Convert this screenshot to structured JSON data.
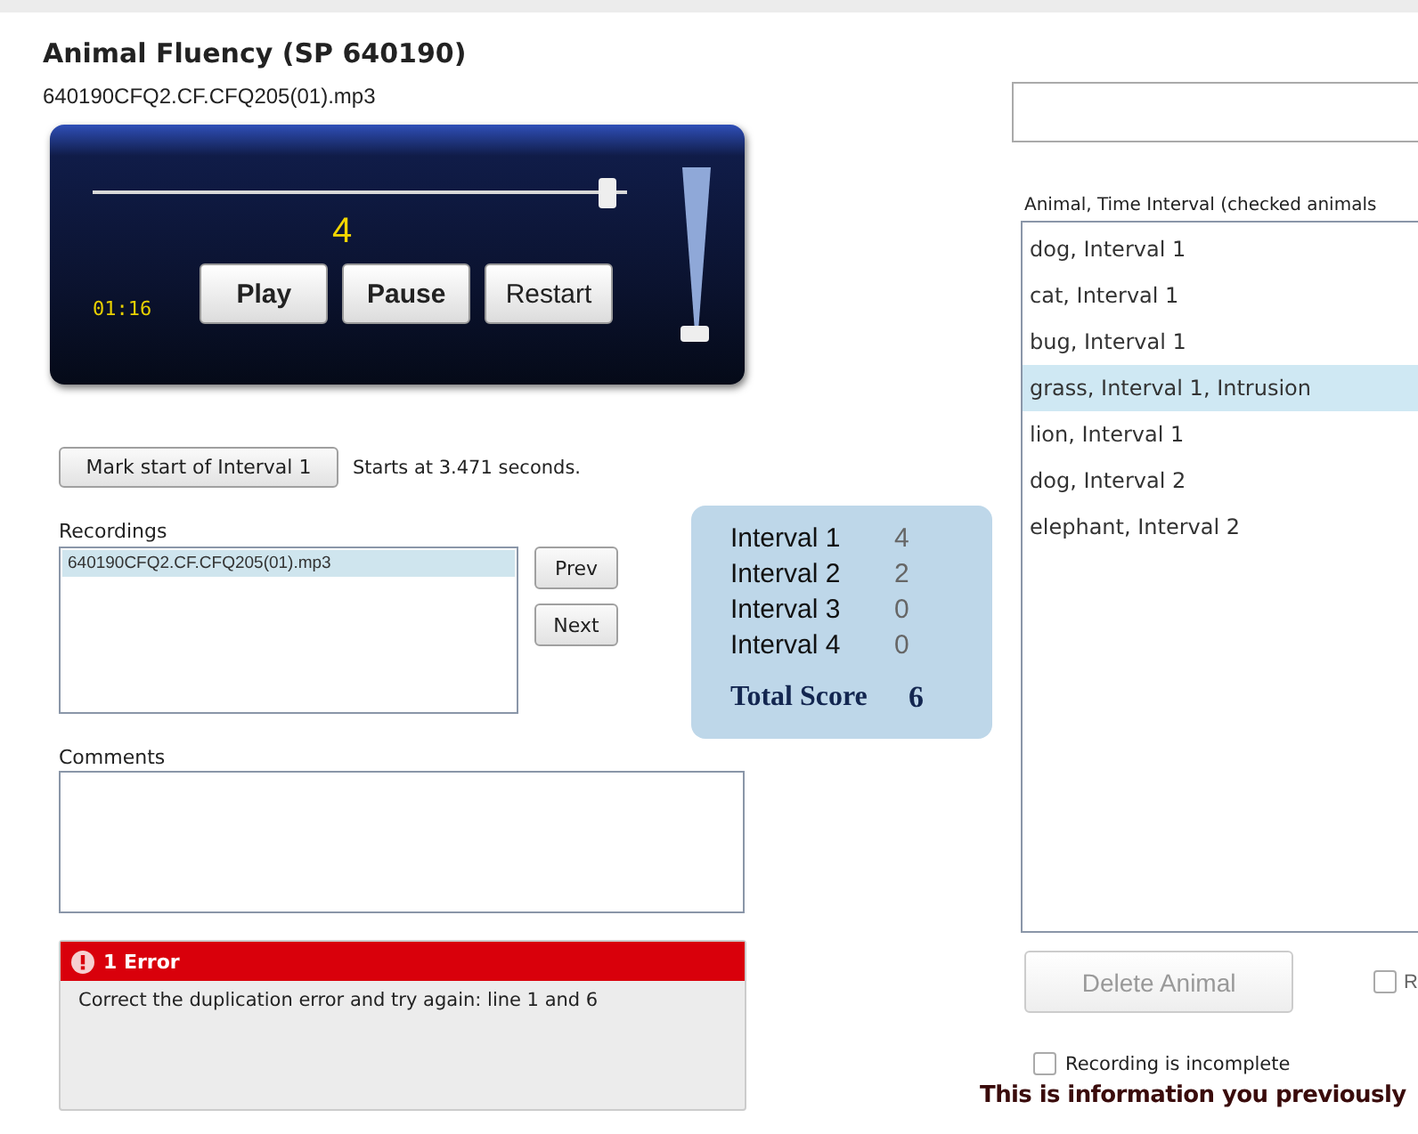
{
  "header": {
    "title": "Animal Fluency (SP 640190)",
    "file": "640190CFQ2.CF.CFQ205(01).mp3"
  },
  "player": {
    "position": {
      "level": 0.98
    },
    "count": "4",
    "time": "01:16",
    "buttons": [
      "Play",
      "Pause",
      "Restart"
    ],
    "volume": {
      "level": 0
    }
  },
  "interval_marker": {
    "button": "Mark start of Interval 1",
    "note": "Starts at 3.471 seconds."
  },
  "recordings": {
    "label": "Recordings",
    "items": [
      {
        "name": "640190CFQ2.CF.CFQ205(01).mp3",
        "selected": true
      }
    ],
    "buttons": [
      "Prev",
      "Next"
    ]
  },
  "score": {
    "intervals": [
      {
        "label": "Interval 1",
        "value": "4"
      },
      {
        "label": "Interval 2",
        "value": "2"
      },
      {
        "label": "Interval 3",
        "value": "0"
      },
      {
        "label": "Interval 4",
        "value": "0"
      }
    ],
    "total_label": "Total Score",
    "total": "6"
  },
  "comments": {
    "label": "Comments"
  },
  "error": {
    "title": "1 Error",
    "message": "Correct the duplication error and try again: line 1 and 6"
  },
  "animals": {
    "label": "Animal, Time Interval (checked animals",
    "items": [
      {
        "text": "dog, Interval 1",
        "selected": false
      },
      {
        "text": "cat, Interval 1",
        "selected": false
      },
      {
        "text": "bug, Interval 1",
        "selected": false
      },
      {
        "text": "grass, Interval 1, Intrusion",
        "selected": true
      },
      {
        "text": "lion, Interval 1",
        "selected": false
      },
      {
        "text": "dog, Interval 2",
        "selected": false
      },
      {
        "text": "elephant, Interval 2",
        "selected": false
      }
    ]
  },
  "delete_button": {
    "label": "Delete Animal",
    "disabled": true
  },
  "side_checkbox": {
    "label": "R",
    "checked": false
  },
  "incomplete": {
    "label": "Recording is incomplete",
    "checked": false
  },
  "notice": "This is information you previously"
}
